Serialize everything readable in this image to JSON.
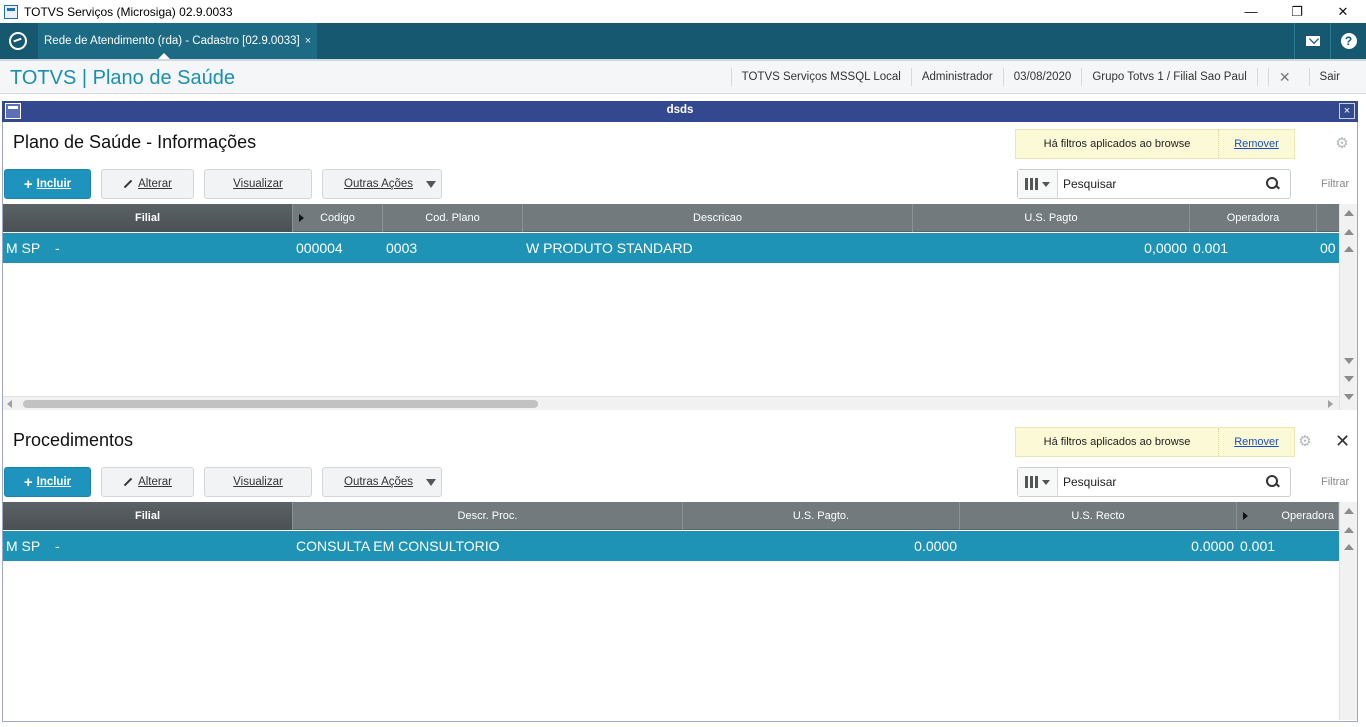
{
  "window": {
    "title": "TOTVS Serviços (Microsiga) 02.9.0033",
    "minimize": "—",
    "restore": "❐",
    "close": "✕"
  },
  "tabs": [
    {
      "label": "Rede de Atendimento (rda) - Cadastro [02.9.0033]",
      "close": "×"
    }
  ],
  "header": {
    "brand": "TOTVS | Plano de Saúde",
    "server": "TOTVS Serviços MSSQL Local",
    "user": "Administrador",
    "date": "03/08/2020",
    "company": "Grupo Totvs 1 / Filial Sao Paul",
    "exit": "Sair"
  },
  "dialog": {
    "title": "dsds",
    "close": "×"
  },
  "browse1": {
    "title": "Plano de Saúde - Informações",
    "filter_text": "Há filtros aplicados ao browse",
    "remove_link": "Remover",
    "btn_incluir": "Incluir",
    "btn_alterar": "Alterar",
    "btn_visualizar": "Visualizar",
    "btn_outras": "Outras Ações",
    "search_placeholder": "Pesquisar",
    "filter_label": "Filtrar",
    "columns": [
      "Filial",
      "Codigo",
      "Cod. Plano",
      "Descricao",
      "U.S. Pagto",
      "Operadora"
    ],
    "row": {
      "filial": "M SP",
      "sep": "-",
      "codigo": "000004",
      "cod_plano": "0003",
      "descricao": "W PRODUTO STANDARD",
      "us_pagto": "0,0000",
      "operadora": "0.001",
      "extra": "00"
    }
  },
  "browse2": {
    "title": "Procedimentos",
    "filter_text": "Há filtros aplicados ao browse",
    "remove_link": "Remover",
    "btn_incluir": "Incluir",
    "btn_alterar": "Alterar",
    "btn_visualizar": "Visualizar",
    "btn_outras": "Outras Ações",
    "search_placeholder": "Pesquisar",
    "filter_label": "Filtrar",
    "columns": [
      "Filial",
      "Descr. Proc.",
      "U.S. Pagto.",
      "U.S. Recto",
      "Operadora"
    ],
    "row": {
      "filial": "M SP",
      "sep": "-",
      "descr": "CONSULTA EM CONSULTORIO",
      "us_pagto": "0.0000",
      "us_recto": "0.0000",
      "operadora": "0.001"
    }
  }
}
